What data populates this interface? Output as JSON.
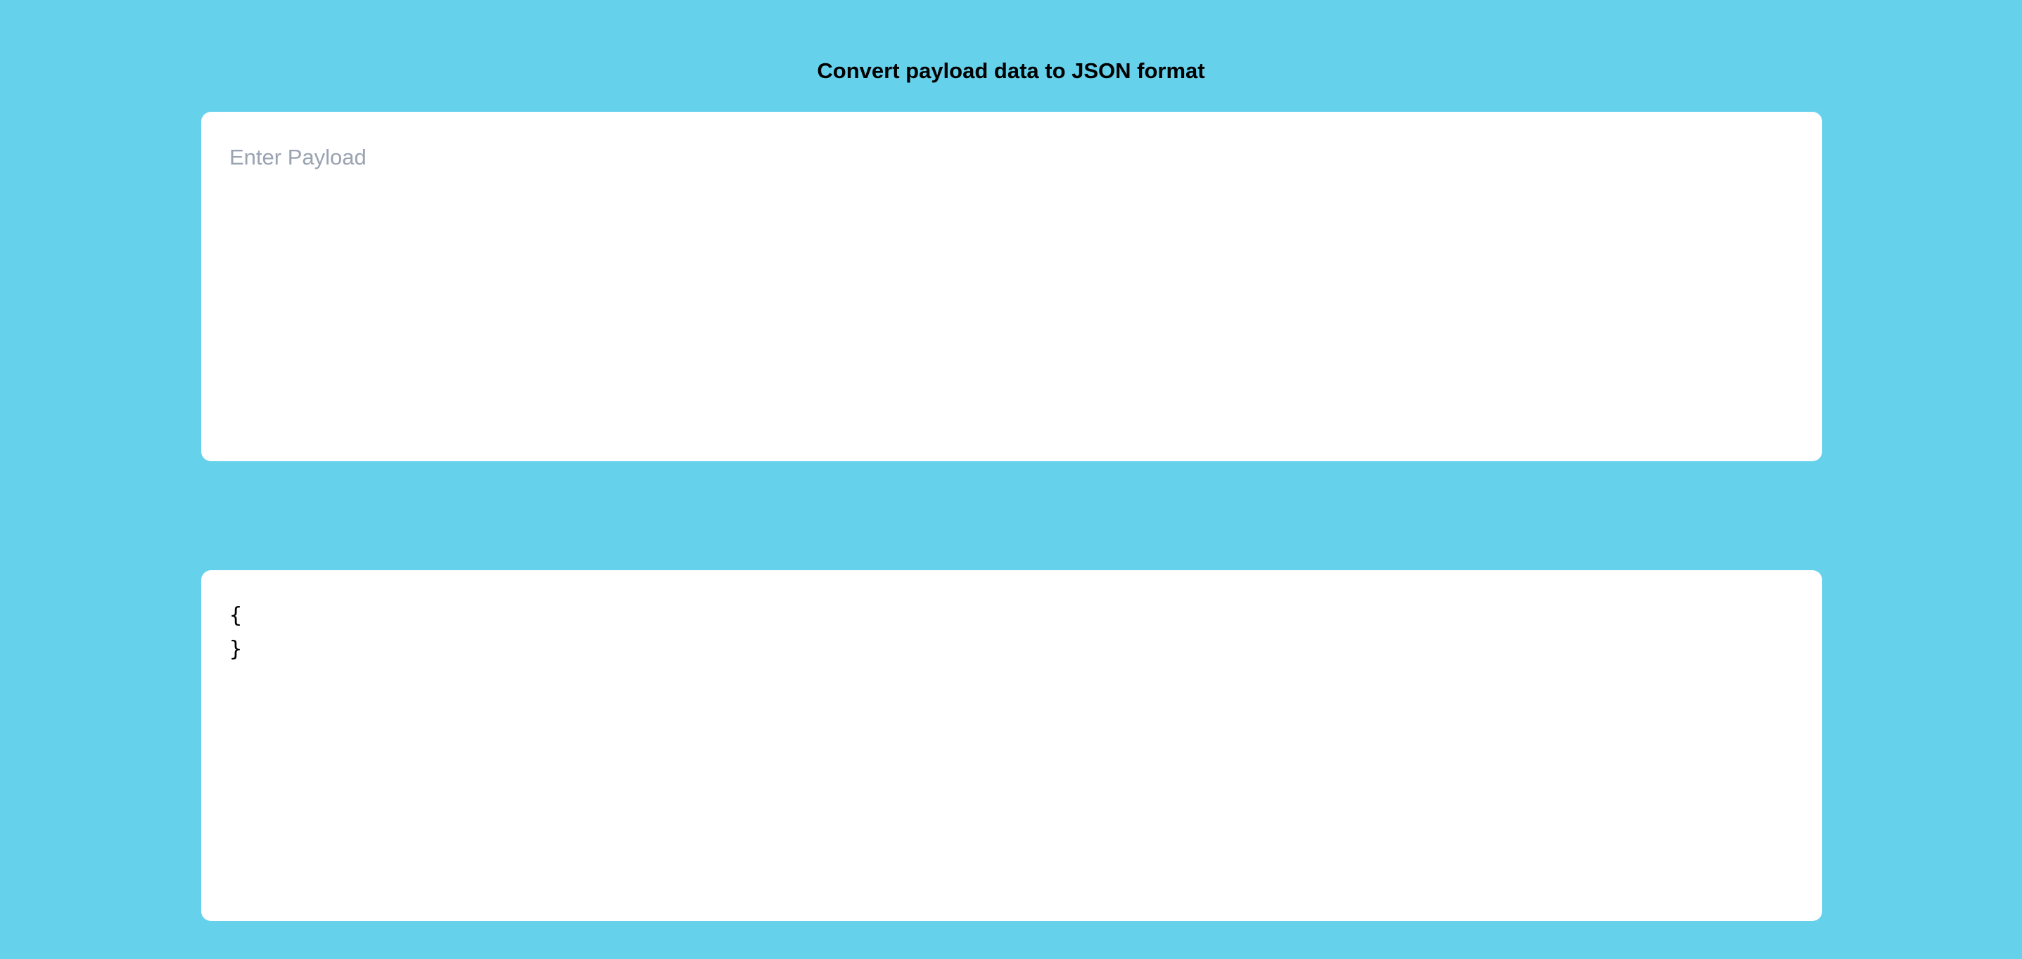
{
  "page": {
    "title": "Convert payload data to JSON format"
  },
  "payload_input": {
    "placeholder": "Enter Payload",
    "value": ""
  },
  "json_output": {
    "text": "{\n}"
  },
  "colors": {
    "background": "#66d1eb",
    "panel": "#ffffff",
    "placeholder": "#9aa3b2",
    "text": "#000000"
  }
}
